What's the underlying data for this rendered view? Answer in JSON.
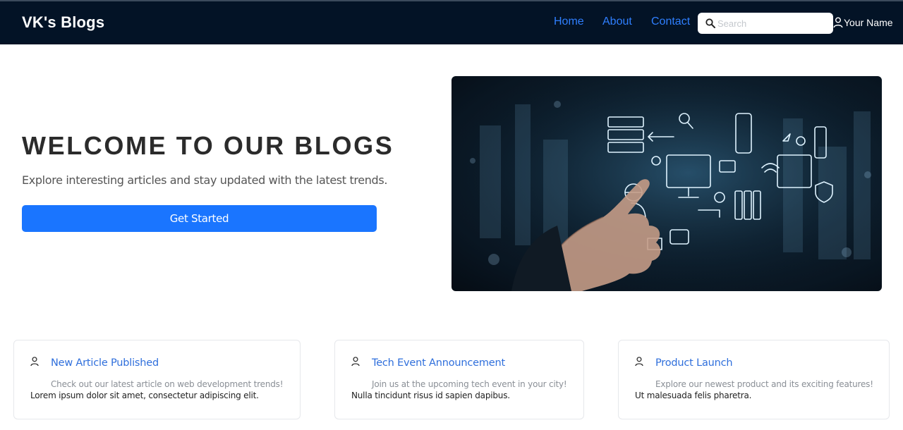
{
  "nav": {
    "brand": "VK's Blogs",
    "links": [
      "Home",
      "About",
      "Contact"
    ],
    "search_placeholder": "Search",
    "user_name": "Your Name"
  },
  "hero": {
    "title": "WELCOME TO OUR BLOGS",
    "subtitle": "Explore interesting articles and stay updated with the latest trends.",
    "cta_label": "Get Started"
  },
  "cards": [
    {
      "title": "New Article Published",
      "description": "Check out our latest article on web development trends!",
      "body": "Lorem ipsum dolor sit amet, consectetur adipiscing elit."
    },
    {
      "title": "Tech Event Announcement",
      "description": "Join us at the upcoming tech event in your city!",
      "body": "Nulla tincidunt risus id sapien dapibus."
    },
    {
      "title": "Product Launch",
      "description": "Explore our newest product and its exciting features!",
      "body": "Ut malesuada felis pharetra."
    }
  ],
  "colors": {
    "navbar": "#031326",
    "nav_link": "#2f7fff",
    "primary_button": "#1a75ff",
    "card_title": "#2f6fdc"
  },
  "icons": [
    "search-icon",
    "user-icon",
    "person-icon"
  ]
}
